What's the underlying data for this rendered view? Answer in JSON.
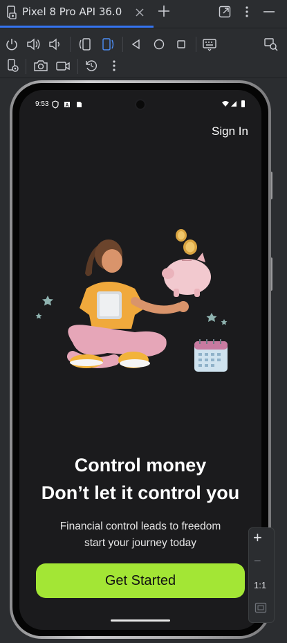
{
  "window": {
    "tab_title": "Pixel 8 Pro API 36.0"
  },
  "icons": {
    "device": "device-icon",
    "close": "close-icon",
    "add": "add-icon",
    "popout": "popout-icon",
    "more": "more-vertical-icon",
    "minimize": "minimize-icon"
  },
  "phone": {
    "status_time": "9:53",
    "sign_in": "Sign In",
    "headline_line1": "Control money",
    "headline_line2": "Don’t let it control you",
    "subline_line1": "Financial control leads to freedom",
    "subline_line2": "start your journey today",
    "cta_label": "Get Started",
    "accent_color": "#a3e635"
  },
  "zoom": {
    "plus": "+",
    "minus": "−",
    "one_to_one": "1:1"
  }
}
